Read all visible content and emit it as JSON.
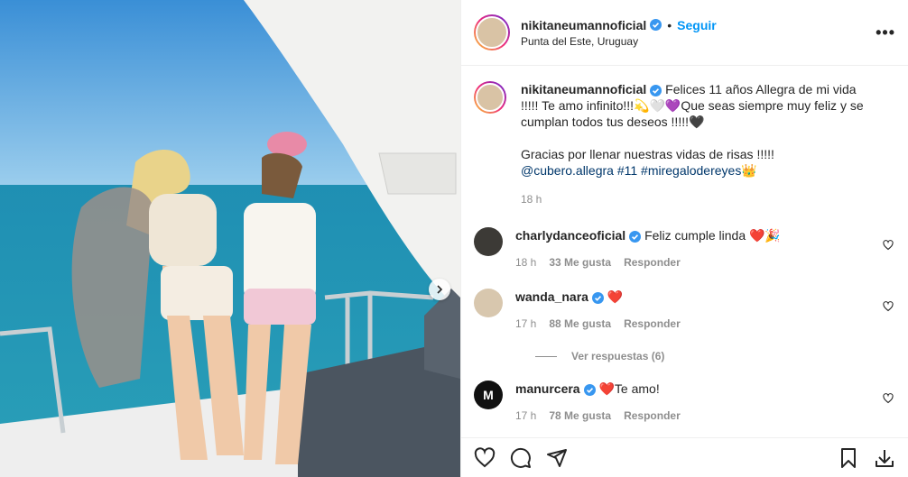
{
  "post": {
    "username": "nikitaneumannoficial",
    "follow_label": "Seguir",
    "dot": "•",
    "location": "Punta del Este, Uruguay",
    "more": "•••"
  },
  "caption": {
    "username": "nikitaneumannoficial",
    "text1": "Felices 11 años Allegra de mi vida !!!!! Te amo infinito!!!💫🤍💜Que seas siempre muy feliz y se cumplan todos tus deseos !!!!!🖤",
    "text2": "Gracias por llenar nuestras vidas de risas !!!!!",
    "mention": "@cubero.allegra",
    "hashtag1": "#11",
    "hashtag2": "#miregalodereyes",
    "emoji_end": "👑",
    "time": "18 h"
  },
  "comments": [
    {
      "username": "charlydanceoficial",
      "text": "Feliz cumple linda ❤️🎉",
      "time": "18 h",
      "likes": "33 Me gusta",
      "reply": "Responder"
    },
    {
      "username": "wanda_nara",
      "text": "❤️",
      "time": "17 h",
      "likes": "88 Me gusta",
      "reply": "Responder"
    },
    {
      "username": "manurcera",
      "text": "❤️Te amo!",
      "time": "17 h",
      "likes": "78 Me gusta",
      "reply": "Responder"
    }
  ],
  "view_replies": "Ver respuestas (6)",
  "icons": [
    "verified-badge-icon",
    "heart-icon",
    "comment-icon",
    "share-icon",
    "bookmark-icon",
    "download-icon",
    "chevron-right-icon",
    "more-options-icon"
  ],
  "colors": {
    "follow": "#0095f6",
    "verified": "#3897f0",
    "muted": "#8e8e8e",
    "link": "#00376b"
  }
}
